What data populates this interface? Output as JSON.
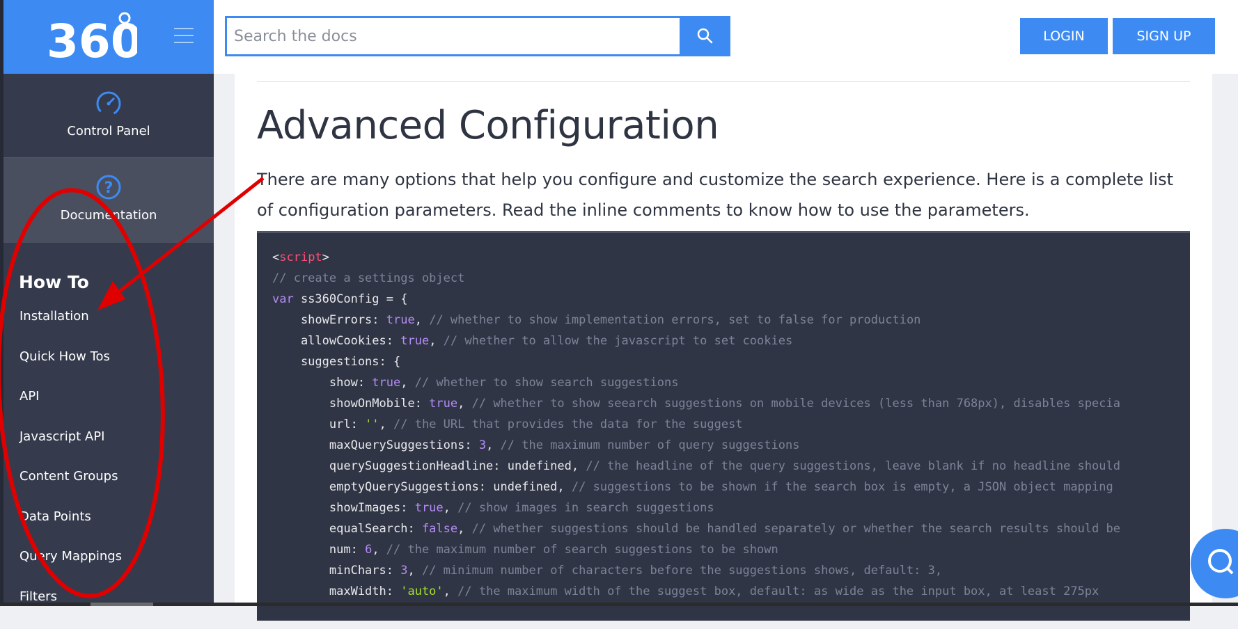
{
  "sidebar": {
    "logo_text": "360°",
    "control_panel_label": "Control Panel",
    "documentation_label": "Documentation",
    "section_title": "How To",
    "items": [
      {
        "label": "Installation"
      },
      {
        "label": "Quick How Tos"
      },
      {
        "label": "API"
      },
      {
        "label": "Javascript API"
      },
      {
        "label": "Content Groups"
      },
      {
        "label": "Data Points"
      },
      {
        "label": "Query Mappings"
      },
      {
        "label": "Filters"
      }
    ]
  },
  "header": {
    "search_placeholder": "Search the docs",
    "login_label": "LOGIN",
    "signup_label": "SIGN UP"
  },
  "main": {
    "title": "Advanced Configuration",
    "intro": "There are many options that help you configure and customize the search experience. Here is a complete list of configuration parameters. Read the inline comments to know how to use the parameters."
  },
  "code_lines": [
    [
      {
        "t": "<",
        "c": ""
      },
      {
        "t": "script",
        "c": "tag"
      },
      {
        "t": ">",
        "c": ""
      }
    ],
    [
      {
        "t": "// create a settings object",
        "c": "cm"
      }
    ],
    [
      {
        "t": "var",
        "c": "kw"
      },
      {
        "t": " ss360Config = {",
        "c": ""
      }
    ],
    [
      {
        "t": "    showErrors: ",
        "c": ""
      },
      {
        "t": "true",
        "c": "kw"
      },
      {
        "t": ", ",
        "c": ""
      },
      {
        "t": "// whether to show implementation errors, set to false for production",
        "c": "cm"
      }
    ],
    [
      {
        "t": "    allowCookies: ",
        "c": ""
      },
      {
        "t": "true",
        "c": "kw"
      },
      {
        "t": ", ",
        "c": ""
      },
      {
        "t": "// whether to allow the javascript to set cookies",
        "c": "cm"
      }
    ],
    [
      {
        "t": "    suggestions: {",
        "c": ""
      }
    ],
    [
      {
        "t": "        show: ",
        "c": ""
      },
      {
        "t": "true",
        "c": "kw"
      },
      {
        "t": ", ",
        "c": ""
      },
      {
        "t": "// whether to show search suggestions",
        "c": "cm"
      }
    ],
    [
      {
        "t": "        showOnMobile: ",
        "c": ""
      },
      {
        "t": "true",
        "c": "kw"
      },
      {
        "t": ", ",
        "c": ""
      },
      {
        "t": "// whether to show seearch suggestions on mobile devices (less than 768px), disables specia",
        "c": "cm"
      }
    ],
    [
      {
        "t": "        url: ",
        "c": ""
      },
      {
        "t": "''",
        "c": "str"
      },
      {
        "t": ", ",
        "c": ""
      },
      {
        "t": "// the URL that provides the data for the suggest",
        "c": "cm"
      }
    ],
    [
      {
        "t": "        maxQuerySuggestions: ",
        "c": ""
      },
      {
        "t": "3",
        "c": "kw"
      },
      {
        "t": ", ",
        "c": ""
      },
      {
        "t": "// the maximum number of query suggestions",
        "c": "cm"
      }
    ],
    [
      {
        "t": "        querySuggestionHeadline: undefined, ",
        "c": ""
      },
      {
        "t": "// the headline of the query suggestions, leave blank if no headline should",
        "c": "cm"
      }
    ],
    [
      {
        "t": "        emptyQuerySuggestions: undefined, ",
        "c": ""
      },
      {
        "t": "// suggestions to be shown if the search box is empty, a JSON object mapping",
        "c": "cm"
      }
    ],
    [
      {
        "t": "        showImages: ",
        "c": ""
      },
      {
        "t": "true",
        "c": "kw"
      },
      {
        "t": ", ",
        "c": ""
      },
      {
        "t": "// show images in search suggestions",
        "c": "cm"
      }
    ],
    [
      {
        "t": "        equalSearch: ",
        "c": ""
      },
      {
        "t": "false",
        "c": "kw"
      },
      {
        "t": ", ",
        "c": ""
      },
      {
        "t": "// whether suggestions should be handled separately or whether the search results should be",
        "c": "cm"
      }
    ],
    [
      {
        "t": "        num: ",
        "c": ""
      },
      {
        "t": "6",
        "c": "kw"
      },
      {
        "t": ", ",
        "c": ""
      },
      {
        "t": "// the maximum number of search suggestions to be shown",
        "c": "cm"
      }
    ],
    [
      {
        "t": "        minChars: ",
        "c": ""
      },
      {
        "t": "3",
        "c": "kw"
      },
      {
        "t": ", ",
        "c": ""
      },
      {
        "t": "// minimum number of characters before the suggestions shows, default: 3,",
        "c": "cm"
      }
    ],
    [
      {
        "t": "        maxWidth: ",
        "c": ""
      },
      {
        "t": "'auto'",
        "c": "str"
      },
      {
        "t": ", ",
        "c": ""
      },
      {
        "t": "// the maximum width of the suggest box, default: as wide as the input box, at least 275px",
        "c": "cm"
      }
    ]
  ],
  "colors": {
    "accent": "#3d8bf2",
    "sidebar_bg": "#353b4d",
    "code_bg": "#303546",
    "annotation": "#e00000"
  }
}
